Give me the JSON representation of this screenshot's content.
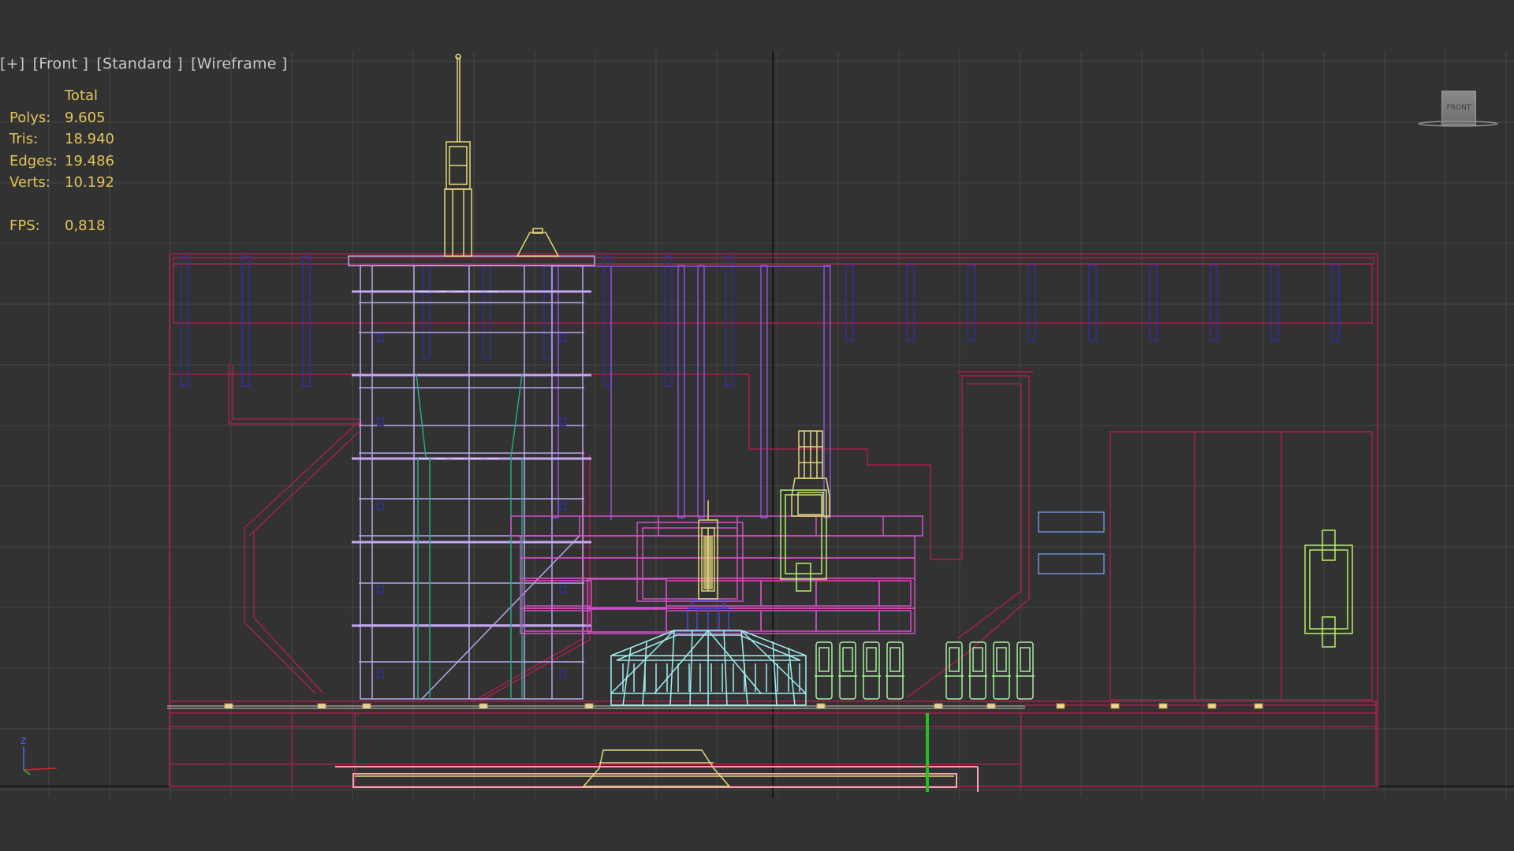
{
  "viewport": {
    "label": {
      "plus": "[+]",
      "view": "[Front ]",
      "shading_mode": "[Standard ]",
      "render_mode": "[Wireframe ]"
    },
    "stats": {
      "header": "Total",
      "polys_label": "Polys:",
      "polys_value": "9.605",
      "tris_label": "Tris:",
      "tris_value": "18.940",
      "edges_label": "Edges:",
      "edges_value": "19.486",
      "verts_label": "Verts:",
      "verts_value": "10.192",
      "fps_label": "FPS:",
      "fps_value": "0,818"
    },
    "viewcube": {
      "face_label": "FRONT",
      "icon": "viewcube-icon"
    },
    "axis_tripod": {
      "z_label": "Z",
      "icon": "axis-tripod-icon"
    }
  },
  "colors": {
    "background": "#323232",
    "grid": "#464646",
    "stats_text": "#e3c35a",
    "label_text": "#c8c8c8",
    "crimson": "#a8204e",
    "magenta": "#d24fc8",
    "lavender": "#b9a6ec",
    "purple": "#8a52de",
    "navy": "#2f2f9c",
    "yellow": "#e6d77a",
    "cyan": "#a0eef2",
    "green": "#a8f0a0",
    "lime": "#b6ef6a",
    "teal": "#2aa88a",
    "blue": "#6f8fd6",
    "pink": "#f2a6b2",
    "pivot_green": "#22c025"
  }
}
